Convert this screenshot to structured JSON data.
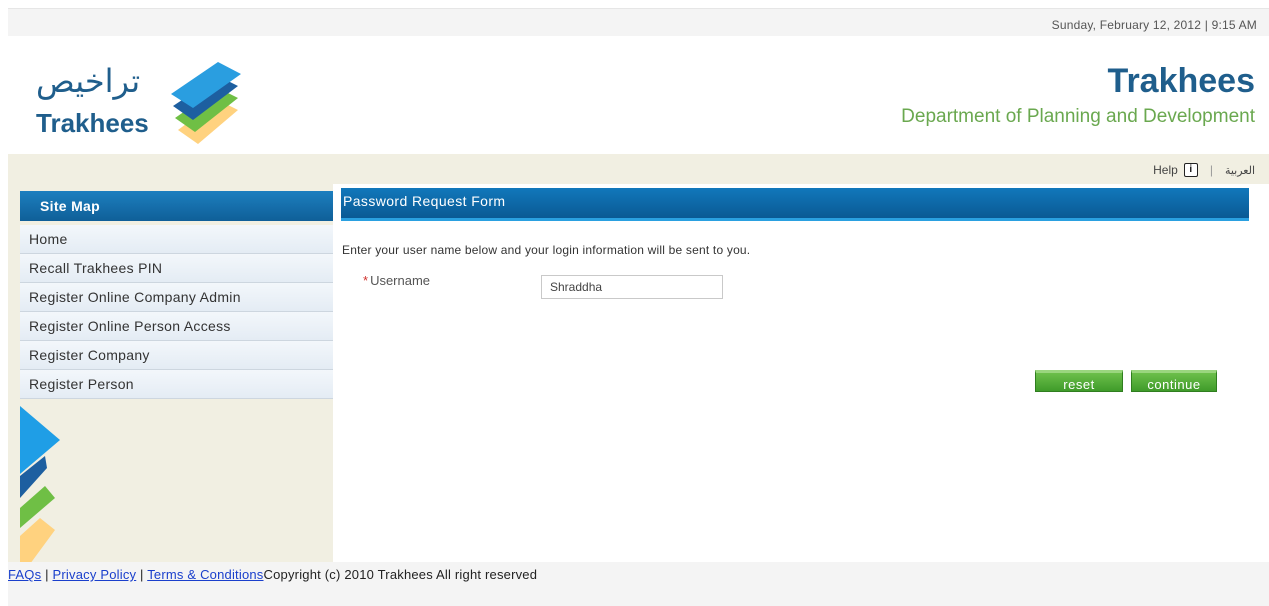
{
  "topbar": {
    "datetime": "Sunday, February 12, 2012 | 9:15 AM"
  },
  "header": {
    "logo_arabic": "تراخيص",
    "logo_english": "Trakhees",
    "title": "Trakhees",
    "subtitle": "Department of Planning and Development",
    "colors": {
      "brand_blue": "#1f5e8c",
      "brand_green": "#6aa84f"
    }
  },
  "utility": {
    "help_label": "Help",
    "info_icon": "i",
    "separator": "|",
    "arabic_label": "العربية"
  },
  "sidebar": {
    "title": "Site Map",
    "items": [
      {
        "label": "Home"
      },
      {
        "label": "Recall Trakhees PIN"
      },
      {
        "label": "Register Online Company Admin"
      },
      {
        "label": "Register Online Person Access"
      },
      {
        "label": "Register Company"
      },
      {
        "label": "Register Person"
      }
    ]
  },
  "form": {
    "title": "Password Request Form",
    "intro": "Enter your user name below  and your login information will be sent to you.",
    "required_mark": "*",
    "username_label": "Username",
    "username_value": "Shraddha",
    "reset_label": "reset",
    "continue_label": "continue",
    "button_color": "#3f9b2a"
  },
  "footer": {
    "faqs": "FAQs",
    "sep": " | ",
    "privacy": "Privacy Policy",
    "terms": "Terms & Conditions",
    "copyright": "Copyright (c) 2010 Trakhees All right reserved"
  }
}
